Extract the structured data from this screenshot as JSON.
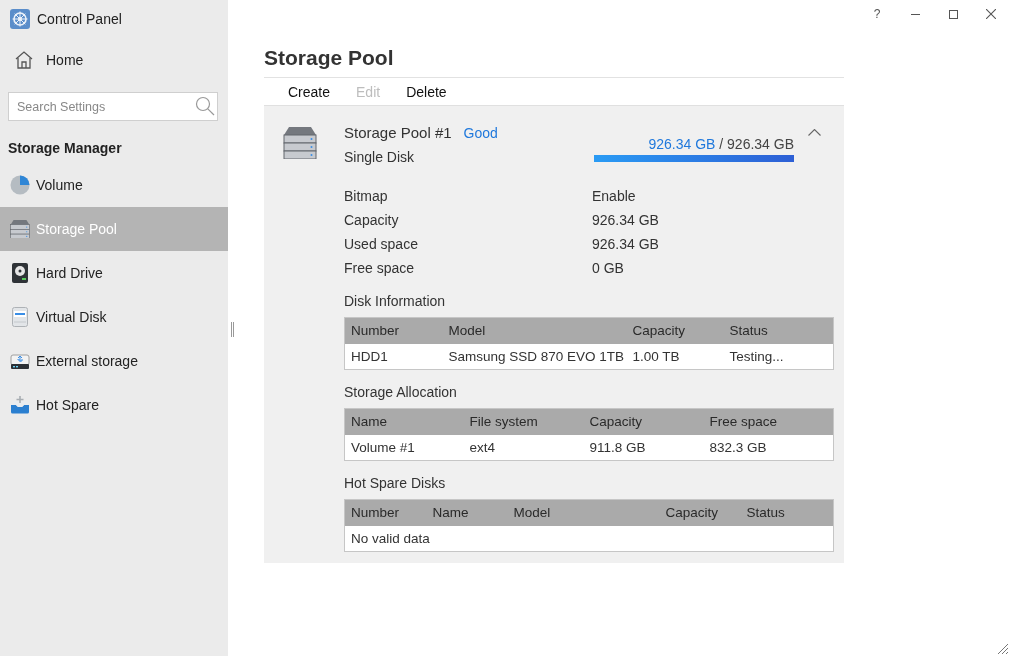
{
  "window": {
    "title": "Control Panel",
    "help": "?"
  },
  "sidebar": {
    "home": "Home",
    "search": {
      "placeholder": "Search Settings"
    },
    "section_title": "Storage Manager",
    "items": [
      {
        "label": "Volume",
        "kind": "volume",
        "selected": false
      },
      {
        "label": "Storage Pool",
        "kind": "pool",
        "selected": true
      },
      {
        "label": "Hard Drive",
        "kind": "hdd",
        "selected": false
      },
      {
        "label": "Virtual Disk",
        "kind": "virtual",
        "selected": false
      },
      {
        "label": "External storage",
        "kind": "external",
        "selected": false
      },
      {
        "label": "Hot Spare",
        "kind": "spare",
        "selected": false
      }
    ]
  },
  "page": {
    "title": "Storage Pool",
    "toolbar": [
      {
        "label": "Create",
        "disabled": false
      },
      {
        "label": "Edit",
        "disabled": true
      },
      {
        "label": "Delete",
        "disabled": false
      }
    ]
  },
  "pool": {
    "name": "Storage Pool #1",
    "status": "Good",
    "type": "Single Disk",
    "expanded": true,
    "usage": {
      "used": "926.34 GB",
      "separator": "/",
      "total": "926.34 GB",
      "level": 1
    },
    "properties": [
      {
        "label": "Bitmap",
        "value": "Enable"
      },
      {
        "label": "Capacity",
        "value": "926.34 GB"
      },
      {
        "label": "Used space",
        "value": "926.34 GB"
      },
      {
        "label": "Free space",
        "value": "0 GB"
      }
    ],
    "sections": [
      {
        "title": "Disk Information",
        "columns": [
          "Number",
          "Model",
          "Capacity",
          "Status"
        ],
        "rows": [
          [
            "HDD1",
            "Samsung SSD 870 EVO 1TB",
            "1.00 TB",
            "Testing..."
          ]
        ]
      },
      {
        "title": "Storage Allocation",
        "columns": [
          "Name",
          "File system",
          "Capacity",
          "Free space"
        ],
        "rows": [
          [
            "Volume #1",
            "ext4",
            "911.8 GB",
            "832.3 GB"
          ]
        ]
      },
      {
        "title": "Hot Spare Disks",
        "columns": [
          "Number",
          "Name",
          "Model",
          "Capacity",
          "Status"
        ],
        "empty_message": "No valid data"
      }
    ]
  }
}
